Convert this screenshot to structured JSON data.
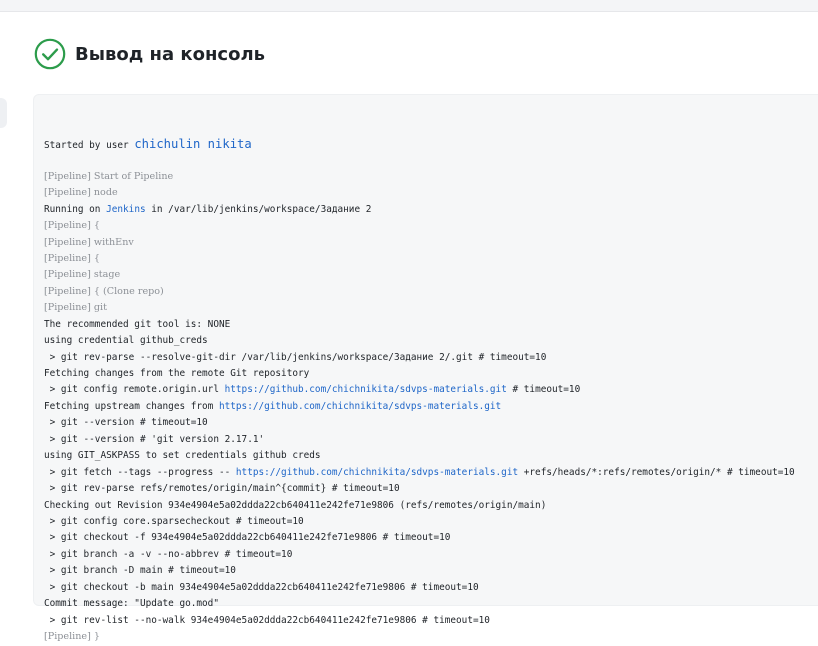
{
  "page": {
    "title": "Вывод на консоль",
    "status_icon": "check-circle-icon",
    "status_color": "#2c9c4b"
  },
  "console": {
    "started_prefix": "Started by user ",
    "started_user": "chichulin nikita",
    "lines": [
      {
        "kind": "pipeline",
        "text": "[Pipeline] Start of Pipeline"
      },
      {
        "kind": "pipeline",
        "text": "[Pipeline] node"
      },
      {
        "kind": "running",
        "prefix": "Running on ",
        "link": "Jenkins",
        "suffix": " in /var/lib/jenkins/workspace/Задание 2"
      },
      {
        "kind": "pipeline",
        "text": "[Pipeline] {"
      },
      {
        "kind": "pipeline",
        "text": "[Pipeline] withEnv"
      },
      {
        "kind": "pipeline",
        "text": "[Pipeline] {"
      },
      {
        "kind": "pipeline",
        "text": "[Pipeline] stage"
      },
      {
        "kind": "pipeline",
        "text": "[Pipeline] { (Clone repo)"
      },
      {
        "kind": "pipeline",
        "text": "[Pipeline] git"
      },
      {
        "kind": "text",
        "text": "The recommended git tool is: NONE"
      },
      {
        "kind": "text",
        "text": "using credential github_creds"
      },
      {
        "kind": "text",
        "text": " > git rev-parse --resolve-git-dir /var/lib/jenkins/workspace/Задание 2/.git # timeout=10"
      },
      {
        "kind": "text",
        "text": "Fetching changes from the remote Git repository"
      },
      {
        "kind": "linked",
        "prefix": " > git config remote.origin.url ",
        "link": "https://github.com/chichnikita/sdvps-materials.git",
        "suffix": " # timeout=10"
      },
      {
        "kind": "linked",
        "prefix": "Fetching upstream changes from ",
        "link": "https://github.com/chichnikita/sdvps-materials.git",
        "suffix": ""
      },
      {
        "kind": "text",
        "text": " > git --version # timeout=10"
      },
      {
        "kind": "text",
        "text": " > git --version # 'git version 2.17.1'"
      },
      {
        "kind": "text",
        "text": "using GIT_ASKPASS to set credentials github creds"
      },
      {
        "kind": "linked",
        "prefix": " > git fetch --tags --progress -- ",
        "link": "https://github.com/chichnikita/sdvps-materials.git",
        "suffix": " +refs/heads/*:refs/remotes/origin/* # timeout=10"
      },
      {
        "kind": "text",
        "text": " > git rev-parse refs/remotes/origin/main^{commit} # timeout=10"
      },
      {
        "kind": "text",
        "text": "Checking out Revision 934e4904e5a02ddda22cb640411e242fe71e9806 (refs/remotes/origin/main)"
      },
      {
        "kind": "text",
        "text": " > git config core.sparsecheckout # timeout=10"
      },
      {
        "kind": "text",
        "text": " > git checkout -f 934e4904e5a02ddda22cb640411e242fe71e9806 # timeout=10"
      },
      {
        "kind": "text",
        "text": " > git branch -a -v --no-abbrev # timeout=10"
      },
      {
        "kind": "text",
        "text": " > git branch -D main # timeout=10"
      },
      {
        "kind": "text",
        "text": " > git checkout -b main 934e4904e5a02ddda22cb640411e242fe71e9806 # timeout=10"
      },
      {
        "kind": "text",
        "text": "Commit message: \"Update go.mod\""
      },
      {
        "kind": "text",
        "text": " > git rev-list --no-walk 934e4904e5a02ddda22cb640411e242fe71e9806 # timeout=10"
      },
      {
        "kind": "pipeline",
        "text": "[Pipeline] }"
      }
    ]
  }
}
